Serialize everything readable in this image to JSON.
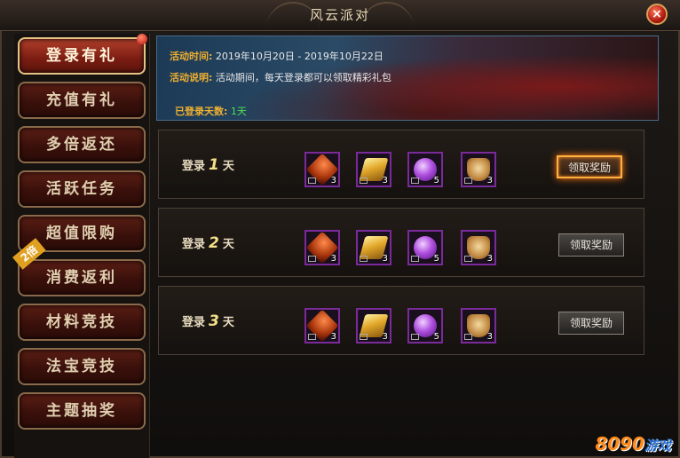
{
  "window": {
    "title": "风云派对",
    "close_label": "×"
  },
  "sidebar": {
    "items": [
      {
        "label": "登录有礼",
        "active": true
      },
      {
        "label": "充值有礼"
      },
      {
        "label": "多倍返还"
      },
      {
        "label": "活跃任务"
      },
      {
        "label": "超值限购"
      },
      {
        "label": "消费返利",
        "badge": "2倍"
      },
      {
        "label": "材料竞技"
      },
      {
        "label": "法宝竞技"
      },
      {
        "label": "主题抽奖"
      }
    ]
  },
  "banner": {
    "time_label": "活动时间:",
    "time_value": "2019年10月20日 - 2019年10月22日",
    "desc_label": "活动说明:",
    "desc_value": "活动期间，每天登录都可以领取精彩礼包",
    "days_label": "已登录天数:",
    "days_value": "1天"
  },
  "rows": [
    {
      "prefix": "登录",
      "day": "1",
      "suffix": "天",
      "button": "领取奖励",
      "items": [
        {
          "icon": "shield-fragment-icon",
          "count": "3"
        },
        {
          "icon": "gold-ingot-icon",
          "count": "3"
        },
        {
          "icon": "purple-orb-icon",
          "count": "5"
        },
        {
          "icon": "talisman-token-icon",
          "count": "3"
        }
      ]
    },
    {
      "prefix": "登录",
      "day": "2",
      "suffix": "天",
      "button": "领取奖励",
      "items": [
        {
          "icon": "shield-fragment-icon",
          "count": "3"
        },
        {
          "icon": "gold-ingot-icon",
          "count": "3"
        },
        {
          "icon": "purple-orb-icon",
          "count": "5"
        },
        {
          "icon": "talisman-token-icon",
          "count": "3"
        }
      ]
    },
    {
      "prefix": "登录",
      "day": "3",
      "suffix": "天",
      "button": "领取奖励",
      "items": [
        {
          "icon": "shield-fragment-icon",
          "count": "3"
        },
        {
          "icon": "gold-ingot-icon",
          "count": "3"
        },
        {
          "icon": "purple-orb-icon",
          "count": "5"
        },
        {
          "icon": "talisman-token-icon",
          "count": "3"
        }
      ]
    }
  ],
  "watermark": {
    "number": "8090",
    "text": "游戏"
  }
}
